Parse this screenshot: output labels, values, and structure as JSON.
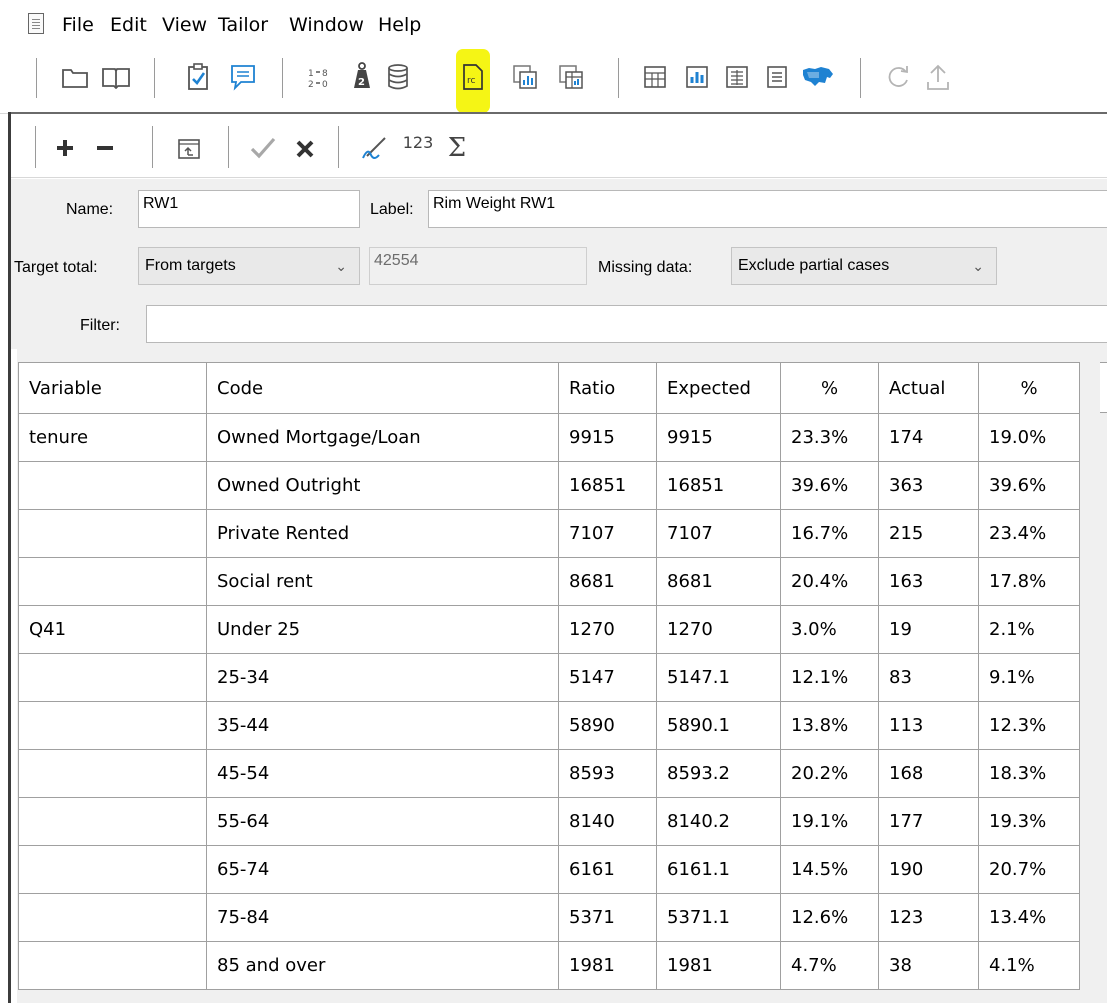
{
  "menu": [
    "File",
    "Edit",
    "View",
    "Tailor",
    "Window",
    "Help"
  ],
  "toolbar_main": {
    "icons": [
      "new-icon",
      "open-book-icon",
      "clipboard-check-icon",
      "comment-icon",
      "numbered-list-icon",
      "weight-icon",
      "database-icon",
      "rim-weight-icon",
      "copy-chart-icon",
      "copy-table-icon",
      "table-icon",
      "bar-chart-icon",
      "grid-icon",
      "report-icon",
      "map-icon",
      "refresh-icon",
      "upload-icon"
    ],
    "highlight_color": "#f5f515"
  },
  "toolbar_sec": {
    "icons": [
      "add-icon",
      "remove-icon",
      "import-icon",
      "check-icon",
      "cancel-icon",
      "edit-pen-icon",
      "numbering-icon",
      "sum-icon"
    ],
    "numbering_text": "123",
    "sum_text": "Σ"
  },
  "form": {
    "name_label": "Name:",
    "name_value": "RW1",
    "label_label": "Label:",
    "label_value": "Rim Weight RW1",
    "target_total_label": "Target total:",
    "target_total_value": "From targets",
    "target_total_number": "42554",
    "missing_data_label": "Missing data:",
    "missing_data_value": "Exclude partial cases",
    "filter_label": "Filter:",
    "filter_value": ""
  },
  "table": {
    "headers": [
      "Variable",
      "Code",
      "Ratio",
      "Expected",
      "%",
      "Actual",
      "%"
    ],
    "rows": [
      [
        "tenure",
        "Owned Mortgage/Loan",
        "9915",
        "9915",
        "23.3%",
        "174",
        "19.0%"
      ],
      [
        "",
        "Owned Outright",
        "16851",
        "16851",
        "39.6%",
        "363",
        "39.6%"
      ],
      [
        "",
        "Private Rented",
        "7107",
        "7107",
        "16.7%",
        "215",
        "23.4%"
      ],
      [
        "",
        "Social rent",
        "8681",
        "8681",
        "20.4%",
        "163",
        "17.8%"
      ],
      [
        "Q41",
        "Under 25",
        "1270",
        "1270",
        "3.0%",
        "19",
        "2.1%"
      ],
      [
        "",
        "25-34",
        "5147",
        "5147.1",
        "12.1%",
        "83",
        "9.1%"
      ],
      [
        "",
        "35-44",
        "5890",
        "5890.1",
        "13.8%",
        "113",
        "12.3%"
      ],
      [
        "",
        "45-54",
        "8593",
        "8593.2",
        "20.2%",
        "168",
        "18.3%"
      ],
      [
        "",
        "55-64",
        "8140",
        "8140.2",
        "19.1%",
        "177",
        "19.3%"
      ],
      [
        "",
        "65-74",
        "6161",
        "6161.1",
        "14.5%",
        "190",
        "20.7%"
      ],
      [
        "",
        "75-84",
        "5371",
        "5371.1",
        "12.6%",
        "123",
        "13.4%"
      ],
      [
        "",
        "85 and over",
        "1981",
        "1981",
        "4.7%",
        "38",
        "4.1%"
      ]
    ]
  }
}
